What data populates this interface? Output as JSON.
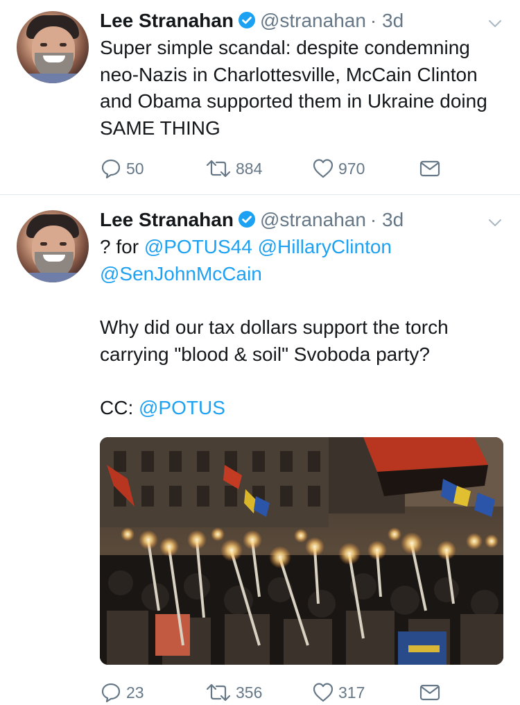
{
  "tweets": [
    {
      "name": "Lee Stranahan",
      "handle": "@stranahan",
      "sep_time": "· 3d",
      "text": "Super simple scandal: despite condemning neo-Nazis in Charlottesville, McCain Clinton and Obama supported them in Ukraine doing SAME THING",
      "replies": "50",
      "retweets": "884",
      "likes": "970"
    },
    {
      "name": "Lee Stranahan",
      "handle": "@stranahan",
      "sep_time": "· 3d",
      "text_q": "? for ",
      "mention1": "@POTUS44",
      "mention2": "@HillaryClinton",
      "mention3": "@SenJohnMcCain",
      "text_body": "Why did our tax dollars support the torch carrying \"blood & soil\" Svoboda party?",
      "text_cc": "CC: ",
      "mention4": "@POTUS",
      "replies": "23",
      "retweets": "356",
      "likes": "317"
    }
  ],
  "colors": {
    "text": "#14171a",
    "secondary": "#657786",
    "link": "#1da1f2",
    "verified": "#1da1f2",
    "divider": "#e1e8ed"
  },
  "icons": {
    "verified": "verified-badge-icon",
    "menu": "chevron-down-icon",
    "reply": "reply-icon",
    "retweet": "retweet-icon",
    "like": "heart-icon",
    "dm": "envelope-icon"
  }
}
